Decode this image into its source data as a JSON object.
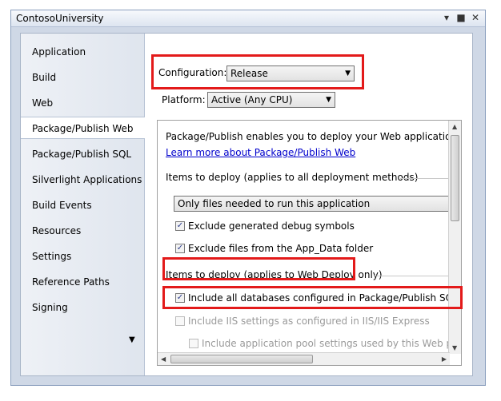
{
  "window": {
    "title": "ContosoUniversity"
  },
  "titlebar_buttons": [
    "▾",
    "■",
    "✕"
  ],
  "sidebar": {
    "items": [
      {
        "label": "Application"
      },
      {
        "label": "Build"
      },
      {
        "label": "Web"
      },
      {
        "label": "Package/Publish Web"
      },
      {
        "label": "Package/Publish SQL"
      },
      {
        "label": "Silverlight Applications"
      },
      {
        "label": "Build Events"
      },
      {
        "label": "Resources"
      },
      {
        "label": "Settings"
      },
      {
        "label": "Reference Paths"
      },
      {
        "label": "Signing"
      }
    ],
    "active": "Package/Publish Web",
    "more_icon": "▼"
  },
  "configuration": {
    "label": "Configuration:",
    "value": "Release"
  },
  "platform": {
    "label": "Platform:",
    "value": "Active (Any CPU)"
  },
  "panel": {
    "intro": "Package/Publish enables you to deploy your Web application to We",
    "learn_more": "Learn more about Package/Publish Web",
    "section1": "Items to deploy (applies to all deployment methods)",
    "deploy_dropdown": "Only files needed to run this application",
    "exclude_debug": "Exclude generated debug symbols",
    "exclude_app_data": "Exclude files from the App_Data folder",
    "section2": "Items to deploy (applies to Web Deploy only)",
    "include_databases": "Include all databases configured in Package/Publish SQL tab",
    "include_iis": "Include IIS settings as configured in IIS/IIS Express",
    "include_app_pool": "Include application pool settings used by this Web project"
  },
  "colors": {
    "highlight": "#e31a1a",
    "link": "#0000cc"
  }
}
